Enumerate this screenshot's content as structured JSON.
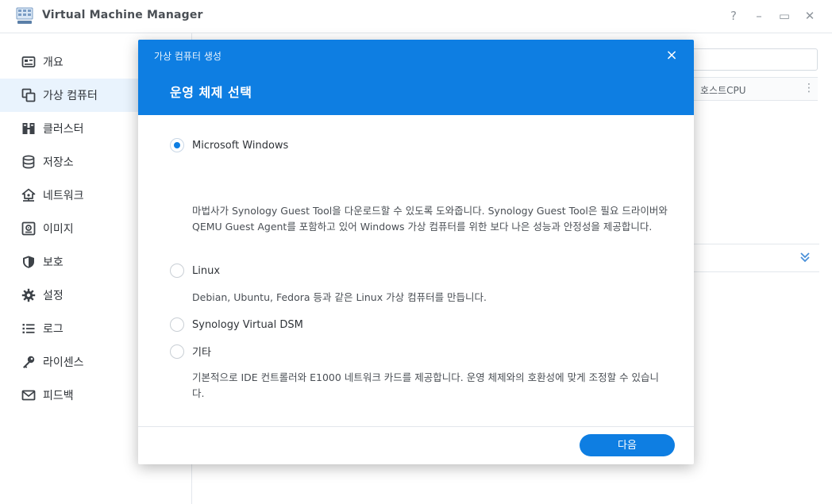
{
  "window": {
    "title": "Virtual Machine Manager",
    "controls": [
      "?",
      "–",
      "▭",
      "✕"
    ]
  },
  "sidebar": {
    "items": [
      {
        "label": "개요",
        "icon": "overview-icon"
      },
      {
        "label": "가상 컴퓨터",
        "icon": "virtual-machine-icon",
        "active": true
      },
      {
        "label": "클러스터",
        "icon": "cluster-icon"
      },
      {
        "label": "저장소",
        "icon": "storage-icon"
      },
      {
        "label": "네트워크",
        "icon": "network-icon"
      },
      {
        "label": "이미지",
        "icon": "image-icon"
      },
      {
        "label": "보호",
        "icon": "shield-icon"
      },
      {
        "label": "설정",
        "icon": "gear-icon"
      },
      {
        "label": "로그",
        "icon": "log-icon"
      },
      {
        "label": "라이센스",
        "icon": "key-icon"
      },
      {
        "label": "피드백",
        "icon": "mail-icon"
      }
    ]
  },
  "main": {
    "column_header": "호스트CPU",
    "more": "⋮"
  },
  "dialog": {
    "title": "가상 컴퓨터 생성",
    "close": "×",
    "step_title": "운영 체제 선택",
    "options": [
      {
        "label": "Microsoft Windows",
        "selected": true,
        "description": "마법사가 Synology Guest Tool을 다운로드할 수 있도록 도와줍니다. Synology Guest Tool은 필요 드라이버와 QEMU Guest Agent를 포함하고 있어 Windows 가상 컴퓨터를 위한 보다 나은 성능과 안정성을 제공합니다."
      },
      {
        "label": "Linux",
        "selected": false,
        "description": "Debian, Ubuntu, Fedora 등과 같은 Linux 가상 컴퓨터를 만듭니다."
      },
      {
        "label": "Synology Virtual DSM",
        "selected": false,
        "description": ""
      },
      {
        "label": "기타",
        "selected": false,
        "description": "기본적으로 IDE 컨트롤러와 E1000 네트워크 카드를 제공합니다. 운영 체제와의 호환성에 맞게 조정할 수 있습니다."
      }
    ],
    "next_label": "다음"
  },
  "colors": {
    "accent": "#0e7ee2",
    "sidebar_active_bg": "#e9f3fd",
    "border": "#e3e7ec"
  }
}
